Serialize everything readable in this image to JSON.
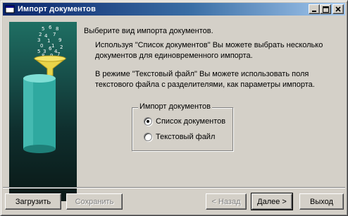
{
  "window": {
    "title": "Импорт документов",
    "controls": [
      "minimize",
      "maximize",
      "close"
    ]
  },
  "illustration": {
    "digits": [
      "5",
      "6",
      "8",
      "2",
      "7",
      "4",
      "3",
      "1",
      "9",
      "0",
      "1",
      "2",
      "3",
      "4",
      "5",
      "6",
      "7",
      "8",
      "9"
    ]
  },
  "content": {
    "heading": "Выберите вид импорта документов.",
    "para1": "Используя \"Список документов\" Вы можете выбрать несколько документов для единовременного импорта.",
    "para2": "В режиме \"Текстовый файл\" Вы можете использовать поля текстового файла с разделителями, как параметры импорта."
  },
  "group": {
    "legend": "Импорт документов",
    "options": [
      {
        "label": "Список документов",
        "checked": true
      },
      {
        "label": "Текстовый файл",
        "checked": false
      }
    ]
  },
  "buttons": {
    "load": "Загрузить",
    "save": "Сохранить",
    "back": "< Назад",
    "next": "Далее >",
    "exit": "Выход"
  }
}
